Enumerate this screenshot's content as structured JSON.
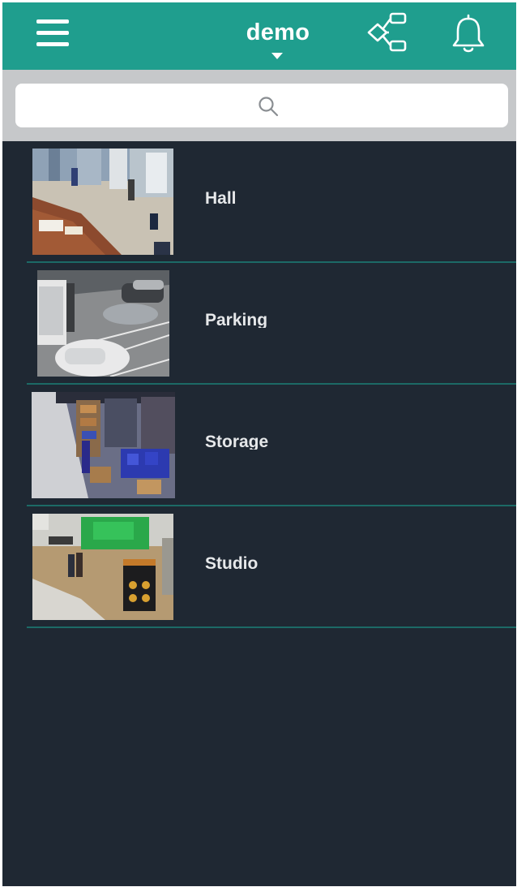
{
  "header": {
    "title": "demo",
    "background_color": "#1f9e8e",
    "menu_icon": "hamburger-menu-icon",
    "layouts_icon": "layout-tree-icon",
    "notifications_icon": "bell-icon"
  },
  "search": {
    "placeholder": "",
    "value": "",
    "icon": "search-icon"
  },
  "cameras": [
    {
      "name": "Hall"
    },
    {
      "name": "Parking"
    },
    {
      "name": "Storage"
    },
    {
      "name": "Studio"
    }
  ],
  "colors": {
    "list_background": "#1f2833",
    "divider": "#1c6a66",
    "search_band": "#c6c8ca",
    "text": "#e6e8ea"
  }
}
